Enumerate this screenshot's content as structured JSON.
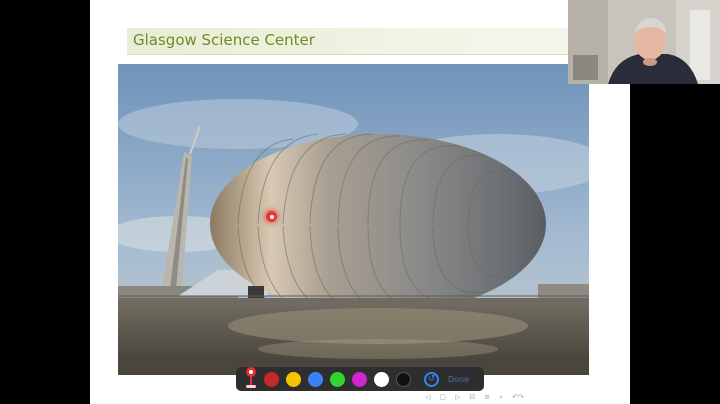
{
  "slide": {
    "title": "Glasgow Science Center",
    "title_color": "#6b8e23"
  },
  "photo": {
    "subject": "Glasgow Science Centre building"
  },
  "annotation_toolbar": {
    "pin_tool": "map-pin-icon",
    "colors": [
      "#c62828",
      "#f5c400",
      "#3b82f6",
      "#31d431",
      "#d026d0",
      "#ffffff",
      "#111111"
    ],
    "color_names": [
      "red",
      "yellow",
      "blue",
      "green",
      "magenta",
      "white",
      "black"
    ],
    "undo_icon": "undo-icon",
    "done_label": "Done"
  },
  "nav": {
    "icons": [
      "slide-prev-icon",
      "slide-next-icon",
      "frame-icon",
      "section-icon",
      "align-icon",
      "search-icon",
      "undo-nav-icon"
    ]
  }
}
